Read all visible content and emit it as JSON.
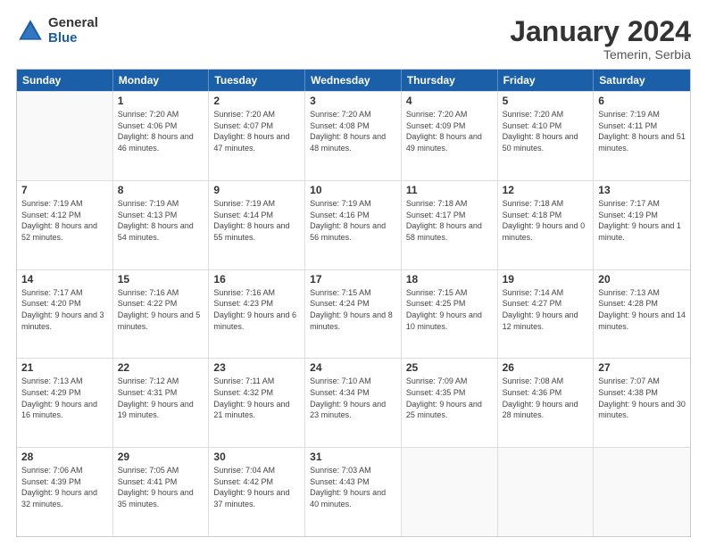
{
  "logo": {
    "general": "General",
    "blue": "Blue"
  },
  "title": "January 2024",
  "location": "Temerin, Serbia",
  "days": [
    "Sunday",
    "Monday",
    "Tuesday",
    "Wednesday",
    "Thursday",
    "Friday",
    "Saturday"
  ],
  "rows": [
    [
      {
        "day": "",
        "empty": true
      },
      {
        "day": "1",
        "sunrise": "7:20 AM",
        "sunset": "4:06 PM",
        "daylight": "8 hours and 46 minutes."
      },
      {
        "day": "2",
        "sunrise": "7:20 AM",
        "sunset": "4:07 PM",
        "daylight": "8 hours and 47 minutes."
      },
      {
        "day": "3",
        "sunrise": "7:20 AM",
        "sunset": "4:08 PM",
        "daylight": "8 hours and 48 minutes."
      },
      {
        "day": "4",
        "sunrise": "7:20 AM",
        "sunset": "4:09 PM",
        "daylight": "8 hours and 49 minutes."
      },
      {
        "day": "5",
        "sunrise": "7:20 AM",
        "sunset": "4:10 PM",
        "daylight": "8 hours and 50 minutes."
      },
      {
        "day": "6",
        "sunrise": "7:19 AM",
        "sunset": "4:11 PM",
        "daylight": "8 hours and 51 minutes."
      }
    ],
    [
      {
        "day": "7",
        "sunrise": "7:19 AM",
        "sunset": "4:12 PM",
        "daylight": "8 hours and 52 minutes."
      },
      {
        "day": "8",
        "sunrise": "7:19 AM",
        "sunset": "4:13 PM",
        "daylight": "8 hours and 54 minutes."
      },
      {
        "day": "9",
        "sunrise": "7:19 AM",
        "sunset": "4:14 PM",
        "daylight": "8 hours and 55 minutes."
      },
      {
        "day": "10",
        "sunrise": "7:19 AM",
        "sunset": "4:16 PM",
        "daylight": "8 hours and 56 minutes."
      },
      {
        "day": "11",
        "sunrise": "7:18 AM",
        "sunset": "4:17 PM",
        "daylight": "8 hours and 58 minutes."
      },
      {
        "day": "12",
        "sunrise": "7:18 AM",
        "sunset": "4:18 PM",
        "daylight": "9 hours and 0 minutes."
      },
      {
        "day": "13",
        "sunrise": "7:17 AM",
        "sunset": "4:19 PM",
        "daylight": "9 hours and 1 minute."
      }
    ],
    [
      {
        "day": "14",
        "sunrise": "7:17 AM",
        "sunset": "4:20 PM",
        "daylight": "9 hours and 3 minutes."
      },
      {
        "day": "15",
        "sunrise": "7:16 AM",
        "sunset": "4:22 PM",
        "daylight": "9 hours and 5 minutes."
      },
      {
        "day": "16",
        "sunrise": "7:16 AM",
        "sunset": "4:23 PM",
        "daylight": "9 hours and 6 minutes."
      },
      {
        "day": "17",
        "sunrise": "7:15 AM",
        "sunset": "4:24 PM",
        "daylight": "9 hours and 8 minutes."
      },
      {
        "day": "18",
        "sunrise": "7:15 AM",
        "sunset": "4:25 PM",
        "daylight": "9 hours and 10 minutes."
      },
      {
        "day": "19",
        "sunrise": "7:14 AM",
        "sunset": "4:27 PM",
        "daylight": "9 hours and 12 minutes."
      },
      {
        "day": "20",
        "sunrise": "7:13 AM",
        "sunset": "4:28 PM",
        "daylight": "9 hours and 14 minutes."
      }
    ],
    [
      {
        "day": "21",
        "sunrise": "7:13 AM",
        "sunset": "4:29 PM",
        "daylight": "9 hours and 16 minutes."
      },
      {
        "day": "22",
        "sunrise": "7:12 AM",
        "sunset": "4:31 PM",
        "daylight": "9 hours and 19 minutes."
      },
      {
        "day": "23",
        "sunrise": "7:11 AM",
        "sunset": "4:32 PM",
        "daylight": "9 hours and 21 minutes."
      },
      {
        "day": "24",
        "sunrise": "7:10 AM",
        "sunset": "4:34 PM",
        "daylight": "9 hours and 23 minutes."
      },
      {
        "day": "25",
        "sunrise": "7:09 AM",
        "sunset": "4:35 PM",
        "daylight": "9 hours and 25 minutes."
      },
      {
        "day": "26",
        "sunrise": "7:08 AM",
        "sunset": "4:36 PM",
        "daylight": "9 hours and 28 minutes."
      },
      {
        "day": "27",
        "sunrise": "7:07 AM",
        "sunset": "4:38 PM",
        "daylight": "9 hours and 30 minutes."
      }
    ],
    [
      {
        "day": "28",
        "sunrise": "7:06 AM",
        "sunset": "4:39 PM",
        "daylight": "9 hours and 32 minutes."
      },
      {
        "day": "29",
        "sunrise": "7:05 AM",
        "sunset": "4:41 PM",
        "daylight": "9 hours and 35 minutes."
      },
      {
        "day": "30",
        "sunrise": "7:04 AM",
        "sunset": "4:42 PM",
        "daylight": "9 hours and 37 minutes."
      },
      {
        "day": "31",
        "sunrise": "7:03 AM",
        "sunset": "4:43 PM",
        "daylight": "9 hours and 40 minutes."
      },
      {
        "day": "",
        "empty": true
      },
      {
        "day": "",
        "empty": true
      },
      {
        "day": "",
        "empty": true
      }
    ]
  ]
}
